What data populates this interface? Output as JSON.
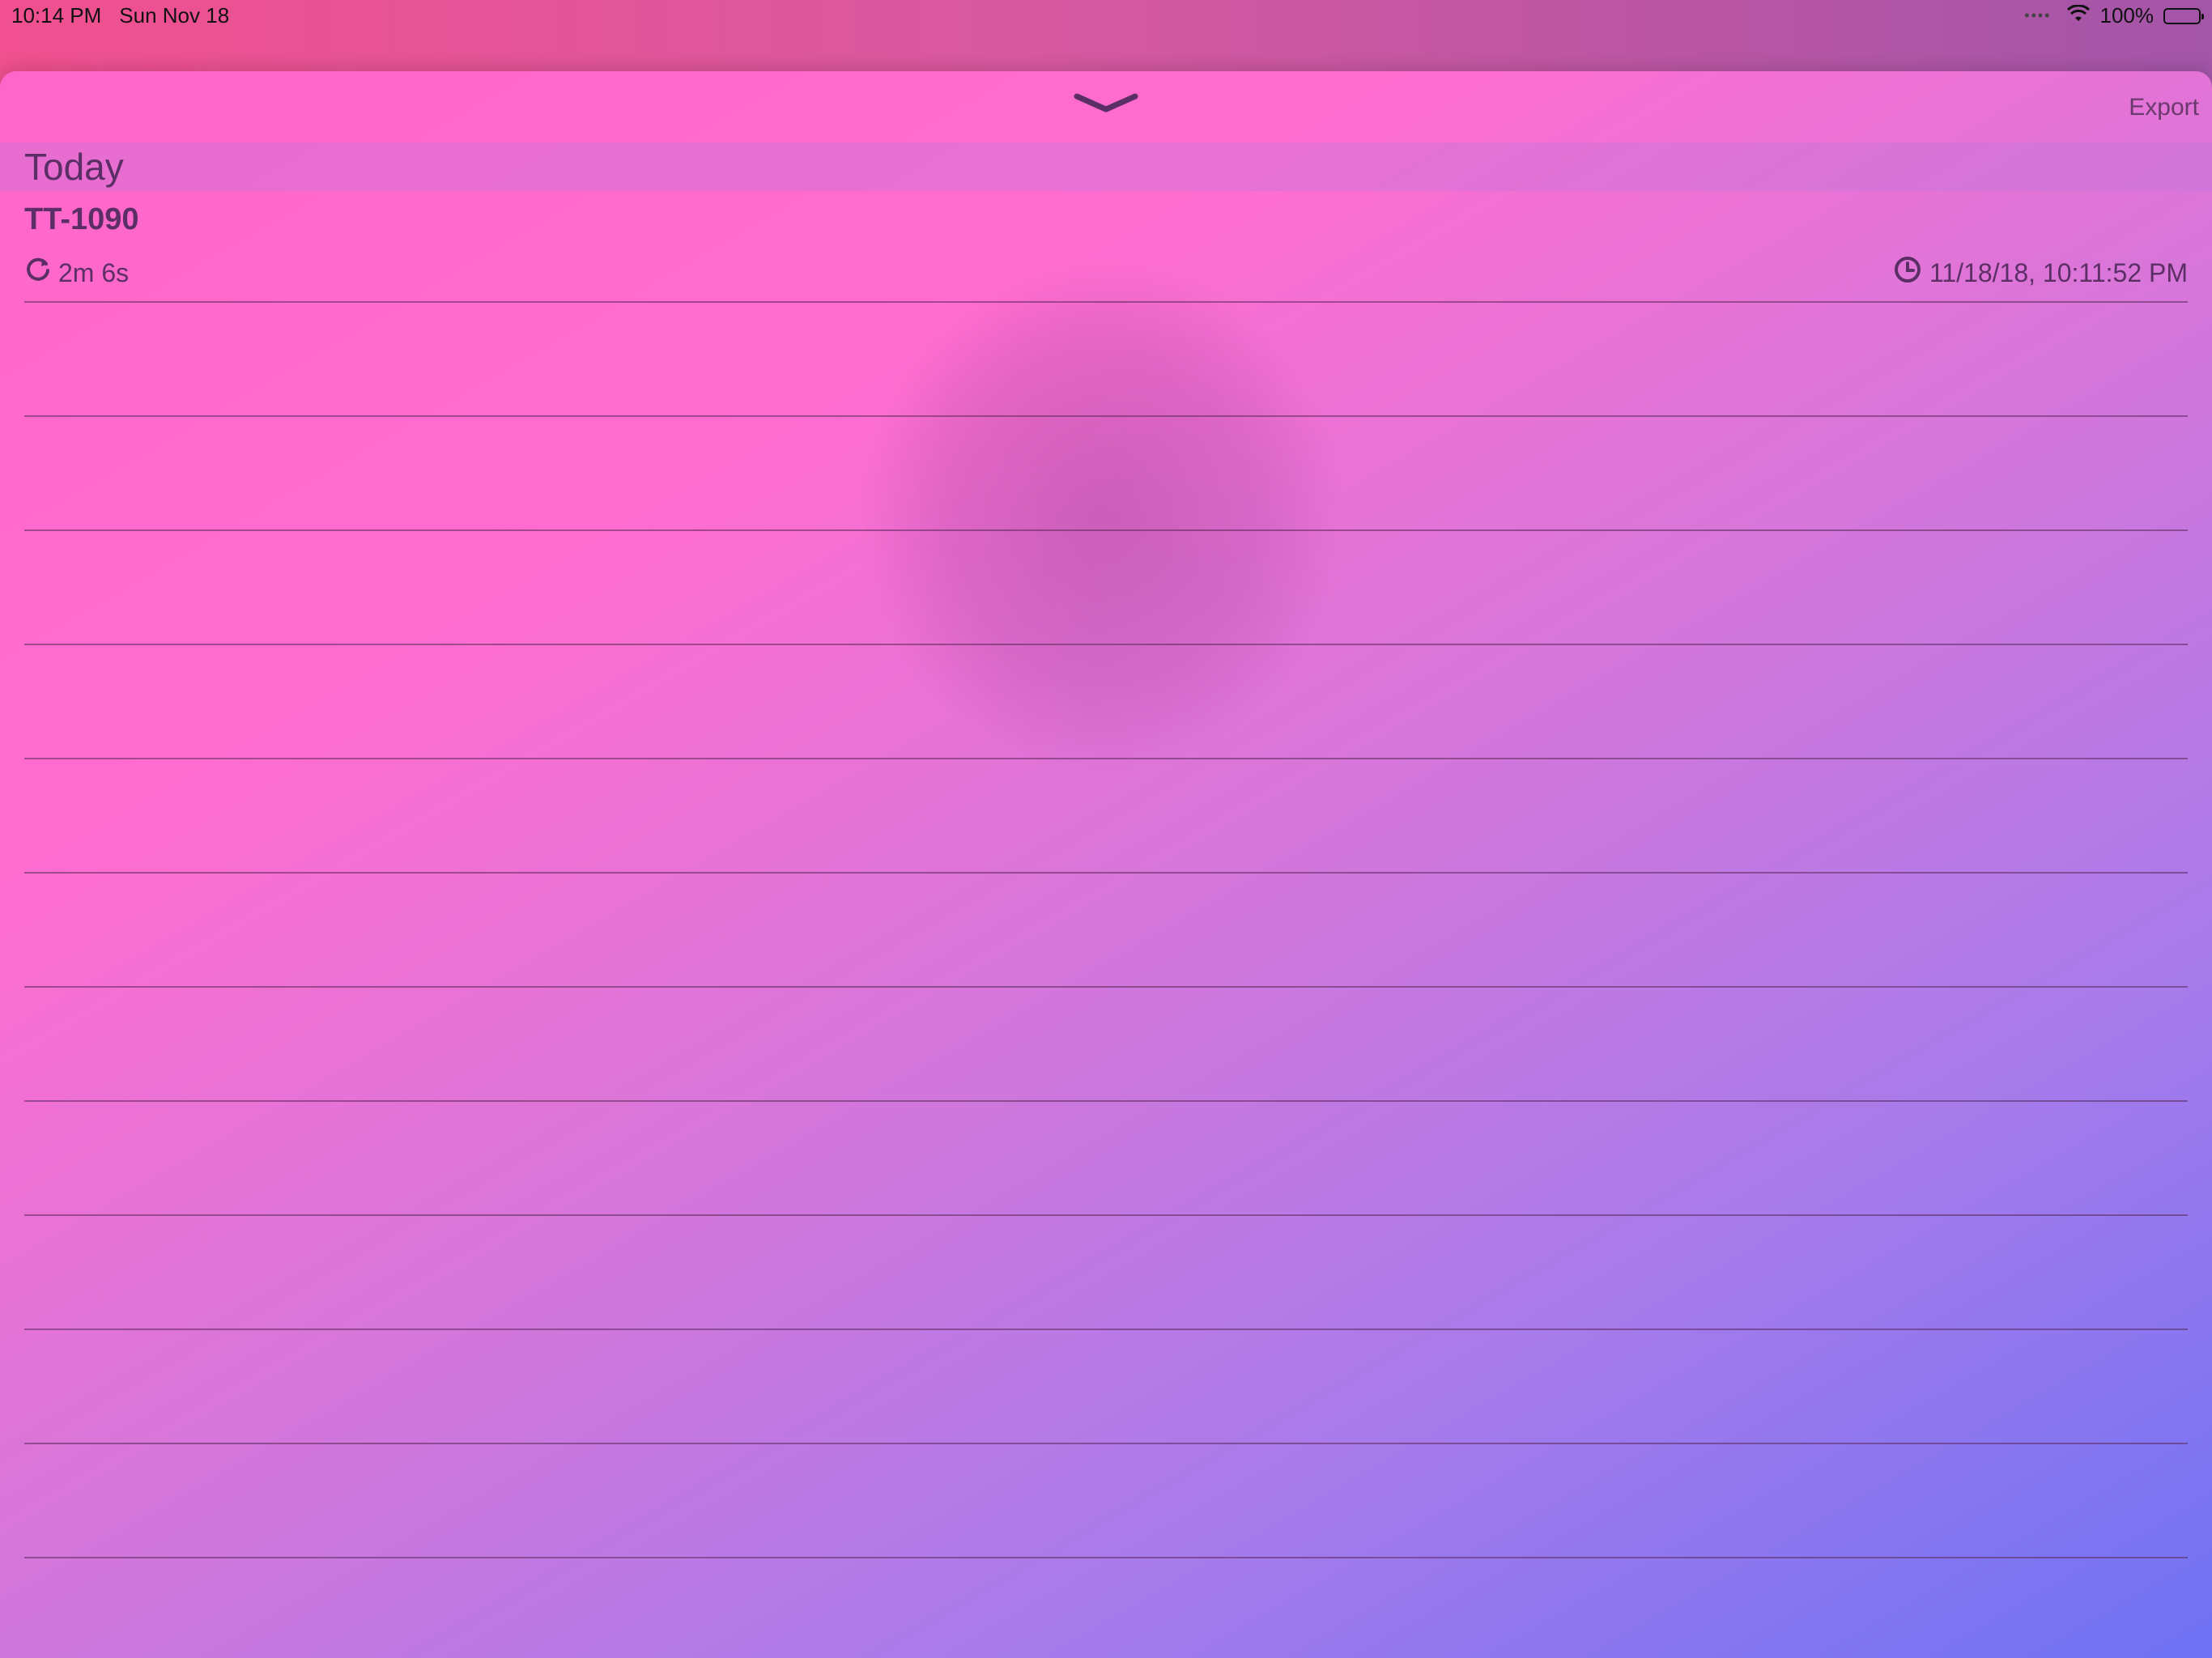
{
  "status_bar": {
    "time": "10:14 PM",
    "date": "Sun Nov 18",
    "battery": "100%",
    "battery_fill": 1.0
  },
  "sheet": {
    "export_label": "Export",
    "grabber_icon": "chevron-down-icon"
  },
  "section": {
    "title": "Today"
  },
  "entries": [
    {
      "title": "TT-1090",
      "duration": "2m 6s",
      "timestamp": "11/18/18, 10:11:52 PM"
    }
  ],
  "colors": {
    "text": "#5b2f66",
    "gradient_start": "#ff66c9",
    "gradient_end": "#6e72f4"
  }
}
